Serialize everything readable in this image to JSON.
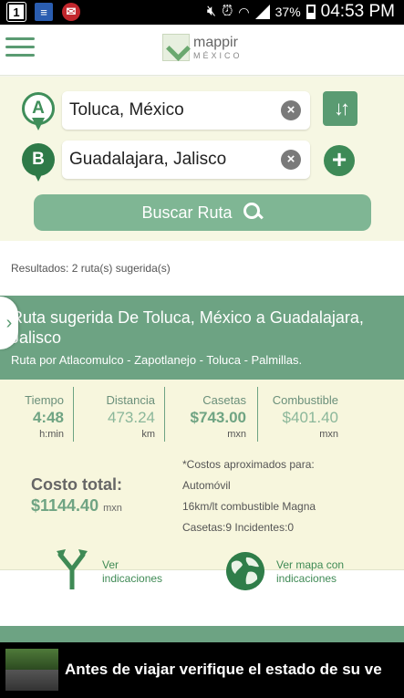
{
  "status_bar": {
    "battery": "37%",
    "time": "04:53 PM",
    "notification_1": "1"
  },
  "header": {
    "logo_name": "mappir",
    "logo_sub": "MÉXICO"
  },
  "search": {
    "origin_marker": "A",
    "destination_marker": "B",
    "origin_value": "Toluca, México",
    "destination_value": "Guadalajara, Jalisco",
    "clear_symbol": "×",
    "search_button": "Buscar Ruta"
  },
  "results": {
    "count_text": "Resultados: 2 ruta(s) sugerida(s)",
    "route": {
      "title": "Ruta sugerida De Toluca, México a Guadalajara, Jalisco",
      "via": "Ruta por Atlacomulco - Zapotlanejo - Toluca - Palmillas.",
      "stats": [
        {
          "label": "Tiempo",
          "value": "4:48",
          "unit": "h:min"
        },
        {
          "label": "Distancia",
          "value": "473.24",
          "unit": "km"
        },
        {
          "label": "Casetas",
          "value": "$743.00",
          "unit": "mxn"
        },
        {
          "label": "Combustible",
          "value": "$401.40",
          "unit": "mxn"
        }
      ],
      "total_label": "Costo total:",
      "total_value": "$1144.40",
      "total_unit": "mxn",
      "notes": [
        "*Costos aproximados para:",
        "Automóvil",
        "16km/lt combustible Magna",
        "Casetas:9 Incidentes:0"
      ],
      "directions_label_1": "Ver",
      "directions_label_2": "indicaciones",
      "map_label_1": "Ver mapa con",
      "map_label_2": "indicaciones"
    }
  },
  "banner": {
    "text": "Antes de viajar verifique el estado de su ve"
  },
  "colors": {
    "primary_green": "#5a9b72",
    "card_header": "#6da383",
    "panel_bg": "#f6f7e3"
  }
}
